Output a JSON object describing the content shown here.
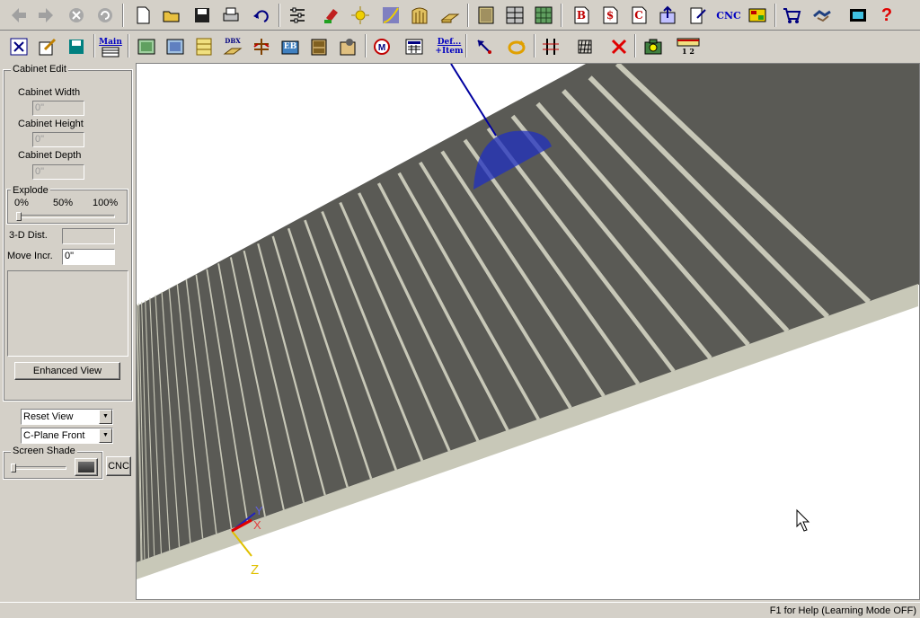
{
  "toolbar1": {
    "icons": [
      "back-arrow-icon",
      "forward-arrow-icon",
      "stop-icon",
      "refresh-icon",
      "new-file-icon",
      "open-folder-icon",
      "save-disk-icon",
      "print-icon",
      "undo-icon",
      "settings-sliders-icon",
      "paint-icon",
      "light-icon",
      "curve-icon",
      "door-icon",
      "panel-icon",
      "cabinet-icon",
      "cabinet-grid-icon",
      "pattern-icon",
      "report-b-icon",
      "report-dollar-icon",
      "report-c-icon",
      "export-icon",
      "edit-report-icon",
      "cnc-text-icon",
      "layout-icon",
      "cart-icon",
      "handshake-icon",
      "film-icon",
      "help-icon"
    ],
    "cnc_label": "CNC",
    "report_b": "B",
    "report_dollar": "$",
    "report_c": "C",
    "help_label": "?"
  },
  "toolbar2": {
    "main_label": "Main",
    "dbx_label": "DBX",
    "eb_label": "EB",
    "def_label": "Def...",
    "item_label": "+Item",
    "ruler_label": "1 2"
  },
  "panel": {
    "group_title": "Cabinet Edit",
    "width_label": "Cabinet Width",
    "width_value": "0\"",
    "height_label": "Cabinet Height",
    "height_value": "0\"",
    "depth_label": "Cabinet Depth",
    "depth_value": "0\"",
    "explode_title": "Explode",
    "explode_0": "0%",
    "explode_50": "50%",
    "explode_100": "100%",
    "dist_label": "3-D Dist.",
    "dist_value": "",
    "move_label": "Move Incr.",
    "move_value": "0\"",
    "enhanced_view": "Enhanced View",
    "reset_view": "Reset View",
    "cplane": "C-Plane Front",
    "screen_shade": "Screen Shade",
    "cnc_button": "CNC"
  },
  "viewport": {
    "axis_x": "X",
    "axis_y": "Y",
    "axis_z": "Z",
    "slat_color": "#5a5a55",
    "edge_color": "#c8c8b8"
  },
  "status": {
    "help_text": "F1 for Help (Learning Mode OFF)"
  }
}
